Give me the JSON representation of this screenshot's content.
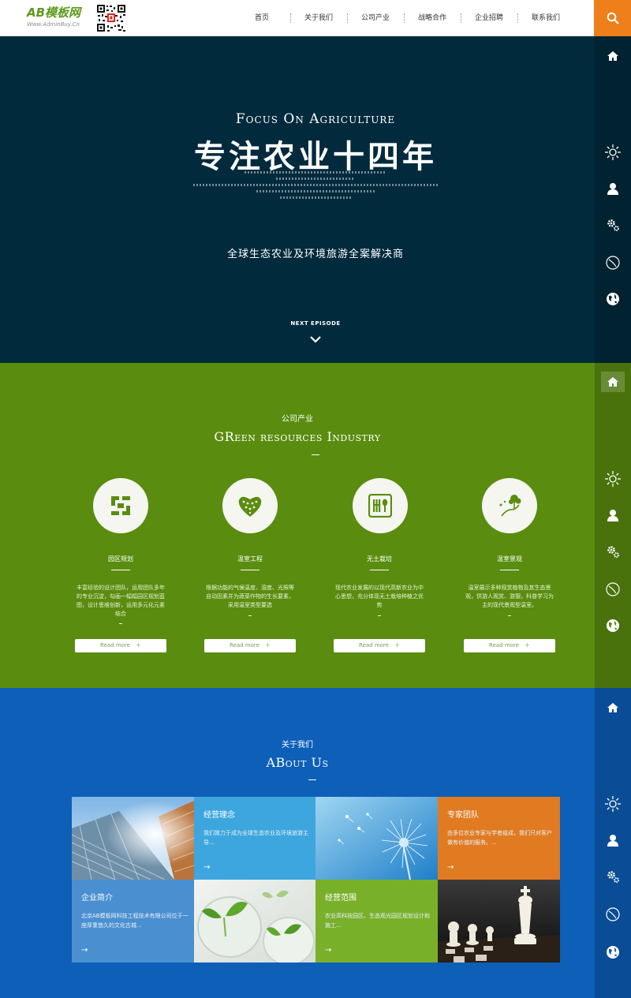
{
  "header": {
    "logo_main": "AB模板网",
    "logo_sub": "Www.AdminBuy.Cn",
    "nav": [
      "首页",
      "关于我们",
      "公司产业",
      "战略合作",
      "企业招聘",
      "联系我们"
    ]
  },
  "hero": {
    "title_en": "Focus On Agriculture",
    "title_cn": "专注农业十四年",
    "tagline": "全球生态农业及环境旅游全案解决商",
    "next_label": "NEXT EPISODE"
  },
  "industry": {
    "subtitle": "公司产业",
    "title": "GReen resources Industry",
    "cards": [
      {
        "title": "园区规划",
        "desc": "丰富经验的设计团队，运用团队多年的专业沉淀，勾画一幅幅园区规划蓝图，设计思维创新，运用多元化元素结合",
        "button": "Read more　＋"
      },
      {
        "title": "温室工程",
        "desc": "根据功能的气候温度、湿度、光照等自动因素并为蔬菜作物的生长要素，采用温室类型要选",
        "button": "Read more　＋"
      },
      {
        "title": "无土栽培",
        "desc": "现代农业发展的以现代高新农业为中心思想，充分体现无土栽培种植之优势",
        "button": "Read more　＋"
      },
      {
        "title": "温室景观",
        "desc": "温室展示多种观赏植物及其生态景观，供游人观赏、游憩，科普学习为主的现代景观型温室。",
        "button": "Read more　＋"
      }
    ]
  },
  "about": {
    "subtitle": "关于我们",
    "title": "ABout Us",
    "tiles": [
      {
        "title": "经营理念",
        "desc": "我们致力于成为全球生态农业及环境旅游主导...",
        "arrow": "→"
      },
      {
        "title": "专家团队",
        "desc": "由多位农业专家与学者组成，我们只对客户做有价值的服务。...",
        "arrow": "→"
      },
      {
        "title": "企业简介",
        "desc": "北京AB模板网科技工程技术有限公司位于一座厚重悠久的文化古城...",
        "arrow": "→"
      },
      {
        "title": "经营范围",
        "desc": "农业高科技园区、生态观光园区规划设计和施工...",
        "arrow": "→"
      }
    ]
  },
  "colors": {
    "hero_bg": "#012a3c",
    "green_bg": "#5a8c0f",
    "blue_bg": "#0d5fb8",
    "accent_orange": "#ee7f1a",
    "tile_sky": "#3ea6de",
    "tile_orange": "#e07b22",
    "tile_blue": "#4a8fd0",
    "tile_green": "#79b02a"
  },
  "sidebar_icons": [
    "home-icon",
    "sun-icon",
    "user-icon",
    "gears-icon",
    "leaf-circle-icon",
    "globe-icon"
  ]
}
